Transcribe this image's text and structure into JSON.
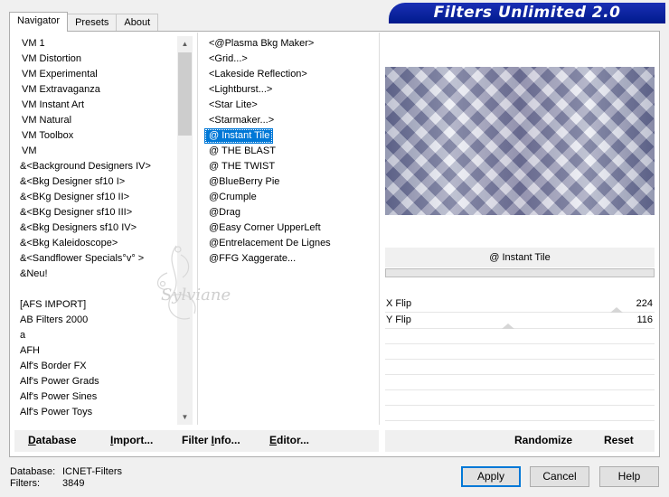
{
  "app_title": "Filters Unlimited 2.0",
  "tabs": [
    {
      "label": "Navigator",
      "active": true
    },
    {
      "label": "Presets",
      "active": false
    },
    {
      "label": "About",
      "active": false
    }
  ],
  "categories": [
    "VM 1",
    "VM Distortion",
    "VM Experimental",
    "VM Extravaganza",
    "VM Instant Art",
    "VM Natural",
    "VM Toolbox",
    "VM",
    "&<Background Designers IV>",
    "&<Bkg Designer sf10 I>",
    "&<BKg Designer sf10 II>",
    "&<BKg Designer sf10 III>",
    "&<Bkg Designers sf10 IV>",
    "&<Bkg Kaleidoscope>",
    "&<Sandflower Specials°v° >",
    "&Neu!",
    "",
    "[AFS IMPORT]",
    "AB Filters 2000",
    "a",
    "AFH",
    "Alf's Border FX",
    "Alf's Power Grads",
    "Alf's Power Sines",
    "Alf's Power Toys"
  ],
  "filters": [
    "<@Plasma Bkg Maker>",
    "<Grid...>",
    "<Lakeside Reflection>",
    "<Lightburst...>",
    "<Star Lite>",
    "<Starmaker...>",
    "@ Instant Tile",
    "@ THE BLAST",
    "@ THE TWIST",
    "@BlueBerry Pie",
    "@Crumple",
    "@Drag",
    "@Easy Corner UpperLeft",
    "@Entrelacement De Lignes",
    "@FFG Xaggerate..."
  ],
  "selected_filter_index": 6,
  "selected_filter_name": "@ Instant Tile",
  "params": [
    {
      "label": "X Flip",
      "value": "224",
      "fraction": 0.878
    },
    {
      "label": "Y Flip",
      "value": "116",
      "fraction": 0.455
    }
  ],
  "bottom_links": {
    "database": {
      "pre": "",
      "ul": "D",
      "post": "atabase"
    },
    "import": {
      "pre": "",
      "ul": "I",
      "post": "mport..."
    },
    "filter_info": {
      "pre": "Filter ",
      "ul": "I",
      "post": "nfo..."
    },
    "editor": {
      "pre": "",
      "ul": "E",
      "post": "ditor..."
    },
    "randomize": {
      "pre": "",
      "ul": "",
      "post": "Randomize"
    },
    "reset": {
      "pre": "",
      "ul": "",
      "post": "Reset"
    }
  },
  "status": {
    "database_label": "Database:",
    "database_value": "ICNET-Filters",
    "filters_label": "Filters:",
    "filters_value": "3849"
  },
  "buttons": {
    "apply": "Apply",
    "cancel": "Cancel",
    "help": "Help"
  },
  "watermark_text": "Sylviane",
  "colors": {
    "title_bar": "#001a8c",
    "selection": "#0078d7"
  }
}
